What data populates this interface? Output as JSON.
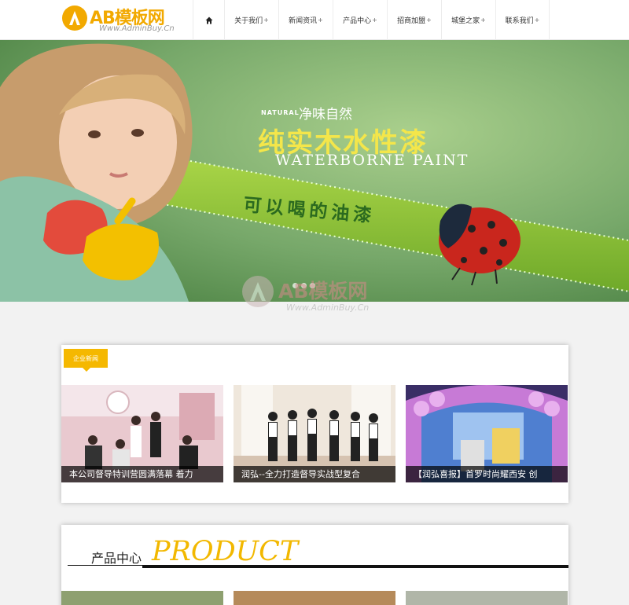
{
  "header": {
    "logo_text": "AB模板网",
    "logo_sub": "Www.AdminBuy.Cn",
    "nav": [
      {
        "label": "关于我们"
      },
      {
        "label": "新闻资讯"
      },
      {
        "label": "产品中心"
      },
      {
        "label": "招商加盟"
      },
      {
        "label": "城堡之家"
      },
      {
        "label": "联系我们"
      }
    ],
    "plus": "+"
  },
  "banner": {
    "natural": "NATURAL",
    "cn_line1": "净味自然",
    "cn_line2": "纯实木水性漆",
    "en_line": "WATERBORNE PAINT",
    "cn_line3": "可以喝的油漆"
  },
  "watermark": {
    "text": "AB模板网",
    "sub": "Www.AdminBuy.Cn"
  },
  "news": {
    "tag": "企业新闻",
    "items": [
      {
        "caption": "本公司督导特训营圆满落幕 着力"
      },
      {
        "caption": "润弘--全力打造督导实战型复合"
      },
      {
        "caption": "【润弘喜报】首罗时尚耀西安 创"
      }
    ]
  },
  "product": {
    "title_cn": "产品中心",
    "title_en": "PRODUCT"
  },
  "colors": {
    "accent": "#f5b800",
    "banner_green": "#6fa262"
  }
}
